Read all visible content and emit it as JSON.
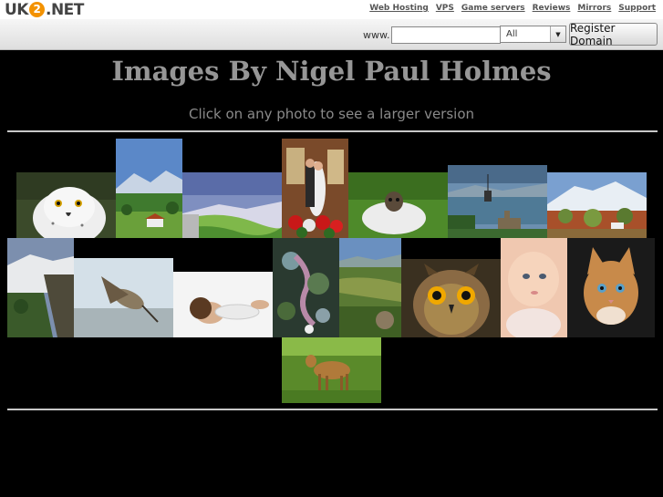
{
  "header": {
    "logo": {
      "uk": "UK",
      "two": "2",
      "net": ".NET"
    },
    "links": [
      "Web Hosting",
      "VPS",
      "Game servers",
      "Reviews",
      "Mirrors",
      "Support"
    ]
  },
  "domain_search": {
    "prefix": "www.",
    "input_value": "",
    "tld_selected": "All",
    "submit_label": "Register Domain"
  },
  "page": {
    "title": "Images By Nigel Paul Holmes",
    "subtitle": "Click on any photo to see a larger version"
  },
  "gallery": {
    "photos": [
      "snowy owl",
      "mountain valley",
      "rolling hills",
      "wedding couple",
      "sheep",
      "castle by the loch",
      "snowy mountain",
      "rocky cliff",
      "curlew bird",
      "woman lying",
      "fantasy art",
      "highland valley",
      "eagle owl",
      "baby",
      "kitten",
      "deer"
    ]
  },
  "colors": {
    "background": "#000000",
    "title": "#969696",
    "accent": "#f39200"
  }
}
